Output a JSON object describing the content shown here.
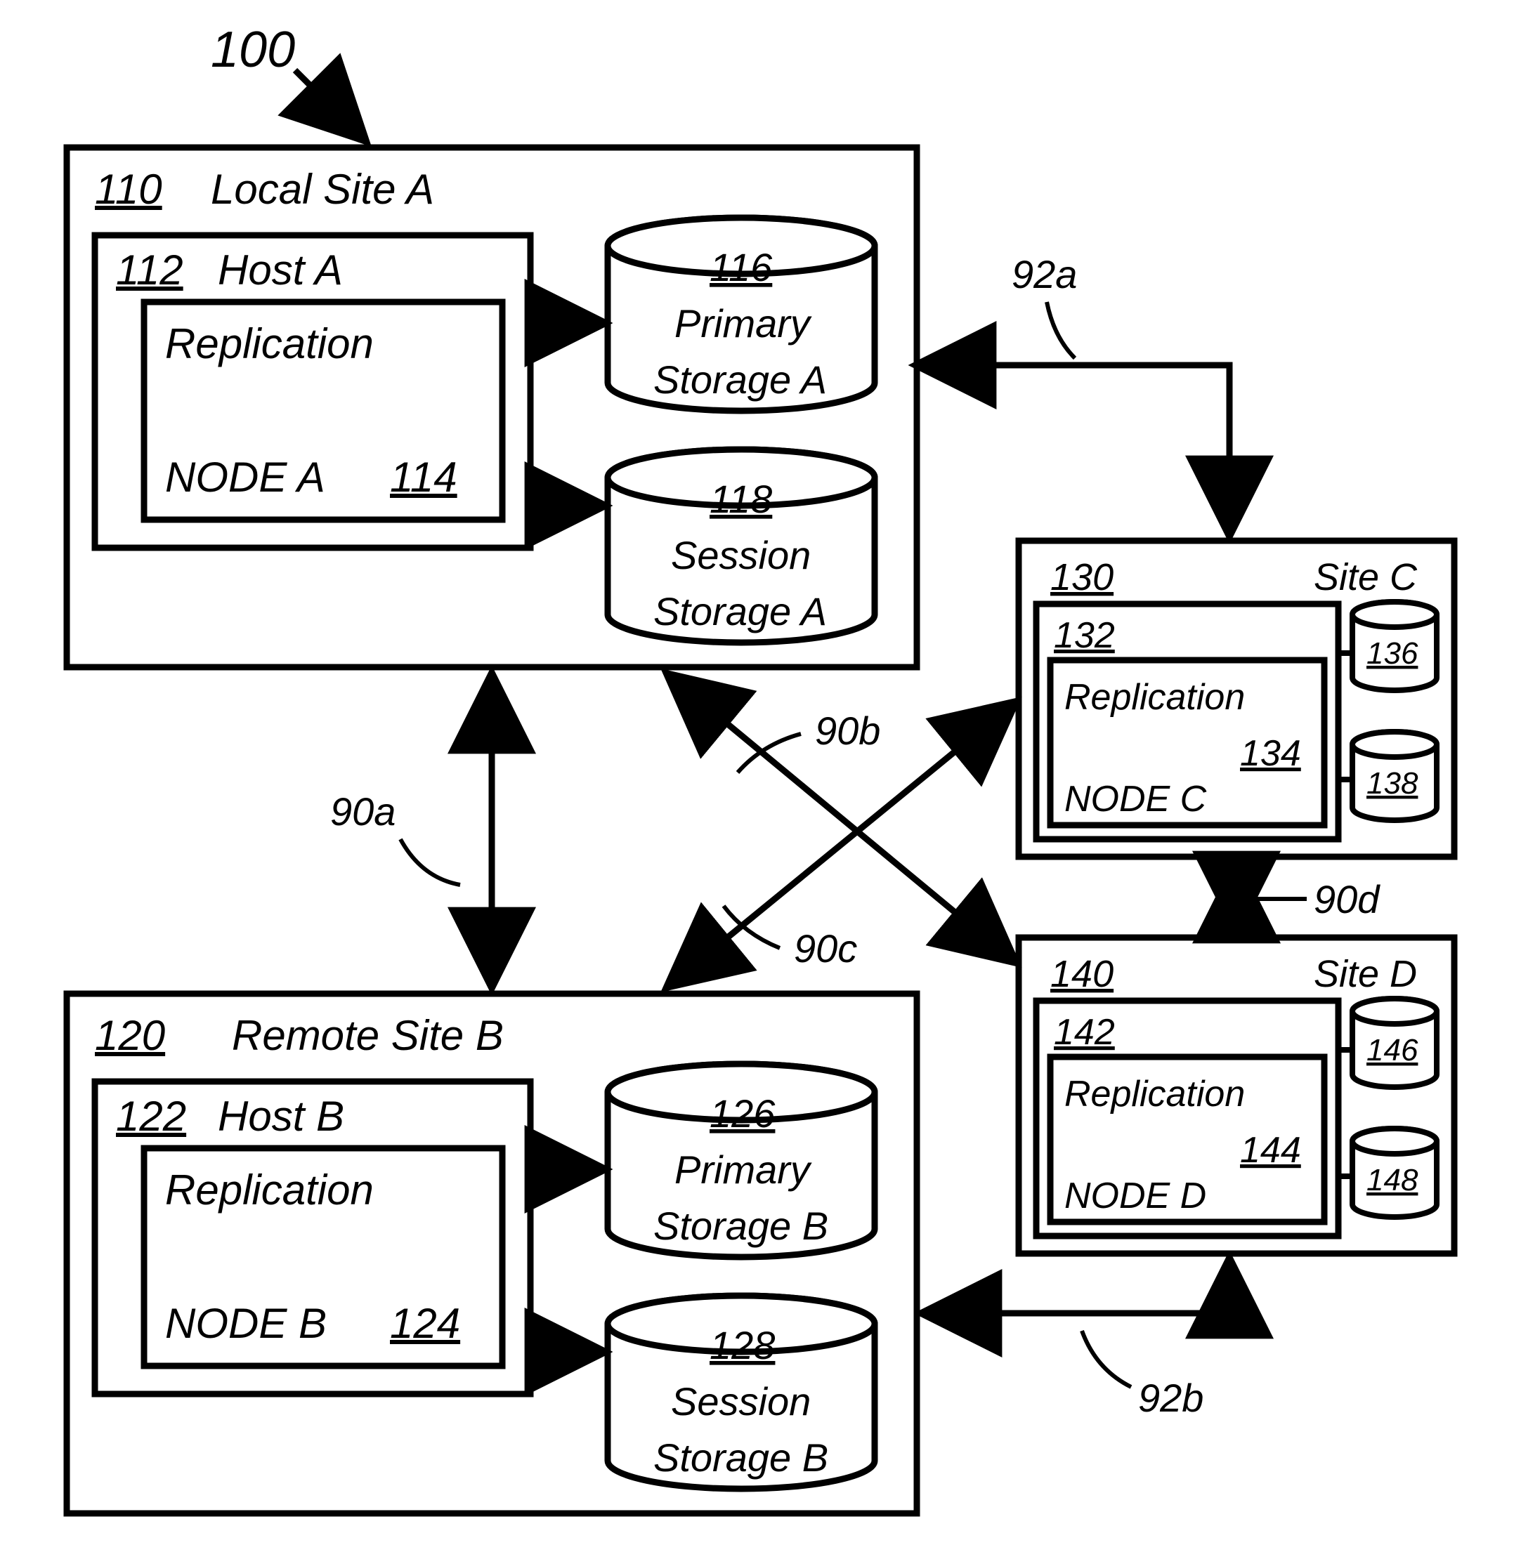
{
  "figure_id": "100",
  "sites": {
    "A": {
      "id": "110",
      "title": "Local Site A",
      "host": {
        "id": "112",
        "title": "Host A"
      },
      "node": {
        "id": "114",
        "title": "NODE A",
        "label": "Replication"
      },
      "primary_storage": {
        "id": "116",
        "title_line1": "Primary",
        "title_line2": "Storage A"
      },
      "session_storage": {
        "id": "118",
        "title_line1": "Session",
        "title_line2": "Storage A"
      }
    },
    "B": {
      "id": "120",
      "title": "Remote Site B",
      "host": {
        "id": "122",
        "title": "Host B"
      },
      "node": {
        "id": "124",
        "title": "NODE B",
        "label": "Replication"
      },
      "primary_storage": {
        "id": "126",
        "title_line1": "Primary",
        "title_line2": "Storage B"
      },
      "session_storage": {
        "id": "128",
        "title_line1": "Session",
        "title_line2": "Storage B"
      }
    },
    "C": {
      "id": "130",
      "title": "Site C",
      "host": {
        "id": "132"
      },
      "node": {
        "id": "134",
        "title": "NODE C",
        "label": "Replication"
      },
      "storage1": {
        "id": "136"
      },
      "storage2": {
        "id": "138"
      }
    },
    "D": {
      "id": "140",
      "title": "Site D",
      "host": {
        "id": "142"
      },
      "node": {
        "id": "144",
        "title": "NODE D",
        "label": "Replication"
      },
      "storage1": {
        "id": "146"
      },
      "storage2": {
        "id": "148"
      }
    }
  },
  "connectors": {
    "c90a": "90a",
    "c90b": "90b",
    "c90c": "90c",
    "c90d": "90d",
    "c92a": "92a",
    "c92b": "92b"
  }
}
